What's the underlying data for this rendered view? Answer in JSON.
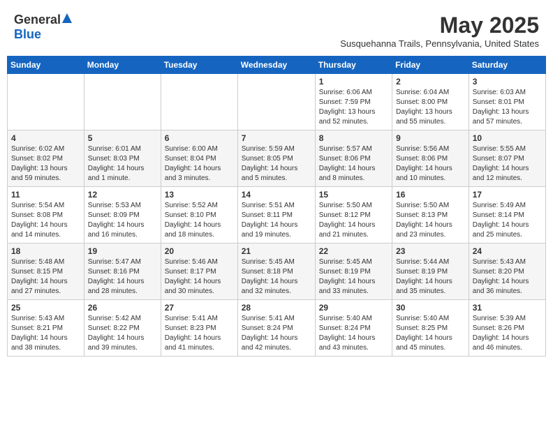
{
  "header": {
    "logo_general": "General",
    "logo_blue": "Blue",
    "month_title": "May 2025",
    "subtitle": "Susquehanna Trails, Pennsylvania, United States"
  },
  "weekdays": [
    "Sunday",
    "Monday",
    "Tuesday",
    "Wednesday",
    "Thursday",
    "Friday",
    "Saturday"
  ],
  "weeks": [
    [
      {
        "day": "",
        "sunrise": "",
        "sunset": "",
        "daylight": ""
      },
      {
        "day": "",
        "sunrise": "",
        "sunset": "",
        "daylight": ""
      },
      {
        "day": "",
        "sunrise": "",
        "sunset": "",
        "daylight": ""
      },
      {
        "day": "",
        "sunrise": "",
        "sunset": "",
        "daylight": ""
      },
      {
        "day": "1",
        "sunrise": "Sunrise: 6:06 AM",
        "sunset": "Sunset: 7:59 PM",
        "daylight": "Daylight: 13 hours and 52 minutes."
      },
      {
        "day": "2",
        "sunrise": "Sunrise: 6:04 AM",
        "sunset": "Sunset: 8:00 PM",
        "daylight": "Daylight: 13 hours and 55 minutes."
      },
      {
        "day": "3",
        "sunrise": "Sunrise: 6:03 AM",
        "sunset": "Sunset: 8:01 PM",
        "daylight": "Daylight: 13 hours and 57 minutes."
      }
    ],
    [
      {
        "day": "4",
        "sunrise": "Sunrise: 6:02 AM",
        "sunset": "Sunset: 8:02 PM",
        "daylight": "Daylight: 13 hours and 59 minutes."
      },
      {
        "day": "5",
        "sunrise": "Sunrise: 6:01 AM",
        "sunset": "Sunset: 8:03 PM",
        "daylight": "Daylight: 14 hours and 1 minute."
      },
      {
        "day": "6",
        "sunrise": "Sunrise: 6:00 AM",
        "sunset": "Sunset: 8:04 PM",
        "daylight": "Daylight: 14 hours and 3 minutes."
      },
      {
        "day": "7",
        "sunrise": "Sunrise: 5:59 AM",
        "sunset": "Sunset: 8:05 PM",
        "daylight": "Daylight: 14 hours and 5 minutes."
      },
      {
        "day": "8",
        "sunrise": "Sunrise: 5:57 AM",
        "sunset": "Sunset: 8:06 PM",
        "daylight": "Daylight: 14 hours and 8 minutes."
      },
      {
        "day": "9",
        "sunrise": "Sunrise: 5:56 AM",
        "sunset": "Sunset: 8:06 PM",
        "daylight": "Daylight: 14 hours and 10 minutes."
      },
      {
        "day": "10",
        "sunrise": "Sunrise: 5:55 AM",
        "sunset": "Sunset: 8:07 PM",
        "daylight": "Daylight: 14 hours and 12 minutes."
      }
    ],
    [
      {
        "day": "11",
        "sunrise": "Sunrise: 5:54 AM",
        "sunset": "Sunset: 8:08 PM",
        "daylight": "Daylight: 14 hours and 14 minutes."
      },
      {
        "day": "12",
        "sunrise": "Sunrise: 5:53 AM",
        "sunset": "Sunset: 8:09 PM",
        "daylight": "Daylight: 14 hours and 16 minutes."
      },
      {
        "day": "13",
        "sunrise": "Sunrise: 5:52 AM",
        "sunset": "Sunset: 8:10 PM",
        "daylight": "Daylight: 14 hours and 18 minutes."
      },
      {
        "day": "14",
        "sunrise": "Sunrise: 5:51 AM",
        "sunset": "Sunset: 8:11 PM",
        "daylight": "Daylight: 14 hours and 19 minutes."
      },
      {
        "day": "15",
        "sunrise": "Sunrise: 5:50 AM",
        "sunset": "Sunset: 8:12 PM",
        "daylight": "Daylight: 14 hours and 21 minutes."
      },
      {
        "day": "16",
        "sunrise": "Sunrise: 5:50 AM",
        "sunset": "Sunset: 8:13 PM",
        "daylight": "Daylight: 14 hours and 23 minutes."
      },
      {
        "day": "17",
        "sunrise": "Sunrise: 5:49 AM",
        "sunset": "Sunset: 8:14 PM",
        "daylight": "Daylight: 14 hours and 25 minutes."
      }
    ],
    [
      {
        "day": "18",
        "sunrise": "Sunrise: 5:48 AM",
        "sunset": "Sunset: 8:15 PM",
        "daylight": "Daylight: 14 hours and 27 minutes."
      },
      {
        "day": "19",
        "sunrise": "Sunrise: 5:47 AM",
        "sunset": "Sunset: 8:16 PM",
        "daylight": "Daylight: 14 hours and 28 minutes."
      },
      {
        "day": "20",
        "sunrise": "Sunrise: 5:46 AM",
        "sunset": "Sunset: 8:17 PM",
        "daylight": "Daylight: 14 hours and 30 minutes."
      },
      {
        "day": "21",
        "sunrise": "Sunrise: 5:45 AM",
        "sunset": "Sunset: 8:18 PM",
        "daylight": "Daylight: 14 hours and 32 minutes."
      },
      {
        "day": "22",
        "sunrise": "Sunrise: 5:45 AM",
        "sunset": "Sunset: 8:19 PM",
        "daylight": "Daylight: 14 hours and 33 minutes."
      },
      {
        "day": "23",
        "sunrise": "Sunrise: 5:44 AM",
        "sunset": "Sunset: 8:19 PM",
        "daylight": "Daylight: 14 hours and 35 minutes."
      },
      {
        "day": "24",
        "sunrise": "Sunrise: 5:43 AM",
        "sunset": "Sunset: 8:20 PM",
        "daylight": "Daylight: 14 hours and 36 minutes."
      }
    ],
    [
      {
        "day": "25",
        "sunrise": "Sunrise: 5:43 AM",
        "sunset": "Sunset: 8:21 PM",
        "daylight": "Daylight: 14 hours and 38 minutes."
      },
      {
        "day": "26",
        "sunrise": "Sunrise: 5:42 AM",
        "sunset": "Sunset: 8:22 PM",
        "daylight": "Daylight: 14 hours and 39 minutes."
      },
      {
        "day": "27",
        "sunrise": "Sunrise: 5:41 AM",
        "sunset": "Sunset: 8:23 PM",
        "daylight": "Daylight: 14 hours and 41 minutes."
      },
      {
        "day": "28",
        "sunrise": "Sunrise: 5:41 AM",
        "sunset": "Sunset: 8:24 PM",
        "daylight": "Daylight: 14 hours and 42 minutes."
      },
      {
        "day": "29",
        "sunrise": "Sunrise: 5:40 AM",
        "sunset": "Sunset: 8:24 PM",
        "daylight": "Daylight: 14 hours and 43 minutes."
      },
      {
        "day": "30",
        "sunrise": "Sunrise: 5:40 AM",
        "sunset": "Sunset: 8:25 PM",
        "daylight": "Daylight: 14 hours and 45 minutes."
      },
      {
        "day": "31",
        "sunrise": "Sunrise: 5:39 AM",
        "sunset": "Sunset: 8:26 PM",
        "daylight": "Daylight: 14 hours and 46 minutes."
      }
    ]
  ]
}
